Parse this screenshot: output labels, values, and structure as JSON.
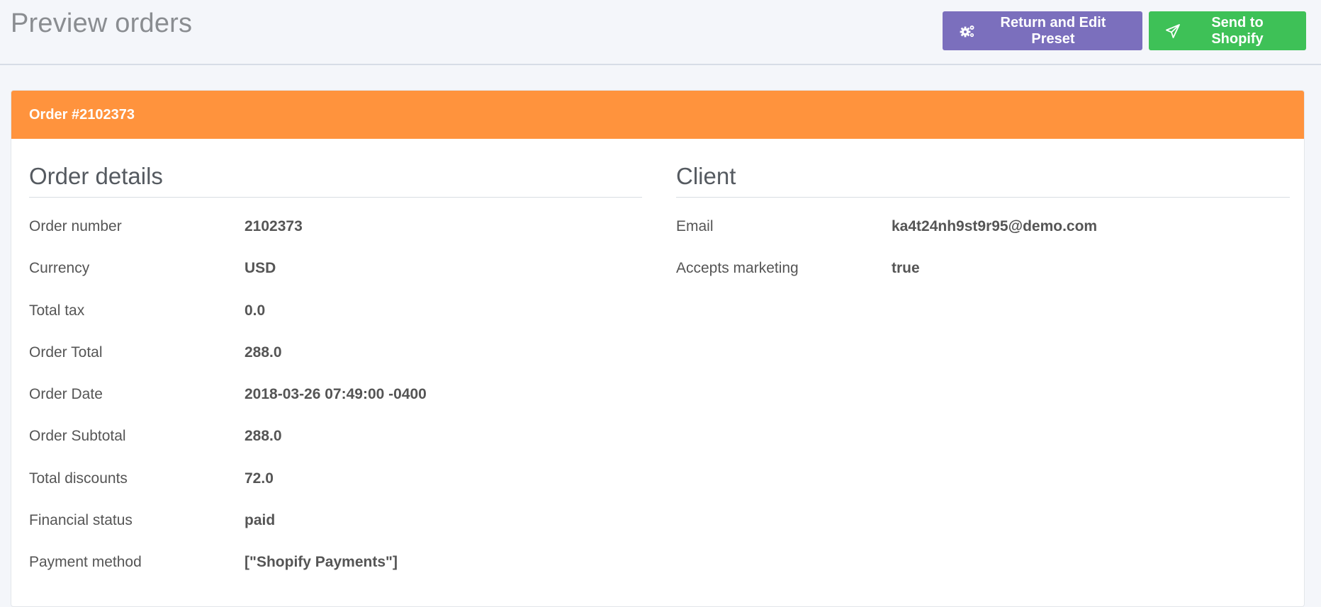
{
  "page": {
    "title": "Preview orders"
  },
  "actions": {
    "return_label": "Return and Edit Preset",
    "send_label": "Send to Shopify"
  },
  "colors": {
    "header_orange": "#ff933d",
    "button_purple": "#7b6fbd",
    "button_green": "#3ec157"
  },
  "icons": {
    "return_icon": "gears-icon",
    "send_icon": "paper-plane-icon"
  },
  "order": {
    "title": "Order #2102373",
    "details": {
      "heading": "Order details",
      "rows": [
        {
          "label": "Order number",
          "value": "2102373"
        },
        {
          "label": "Currency",
          "value": "USD"
        },
        {
          "label": "Total tax",
          "value": "0.0"
        },
        {
          "label": "Order Total",
          "value": "288.0"
        },
        {
          "label": "Order Date",
          "value": "2018-03-26 07:49:00 -0400"
        },
        {
          "label": "Order Subtotal",
          "value": "288.0"
        },
        {
          "label": "Total discounts",
          "value": "72.0"
        },
        {
          "label": "Financial status",
          "value": "paid"
        },
        {
          "label": "Payment method",
          "value": "[\"Shopify Payments\"]"
        }
      ]
    },
    "client": {
      "heading": "Client",
      "rows": [
        {
          "label": "Email",
          "value": "ka4t24nh9st9r95@demo.com"
        },
        {
          "label": "Accepts marketing",
          "value": "true"
        }
      ]
    }
  }
}
